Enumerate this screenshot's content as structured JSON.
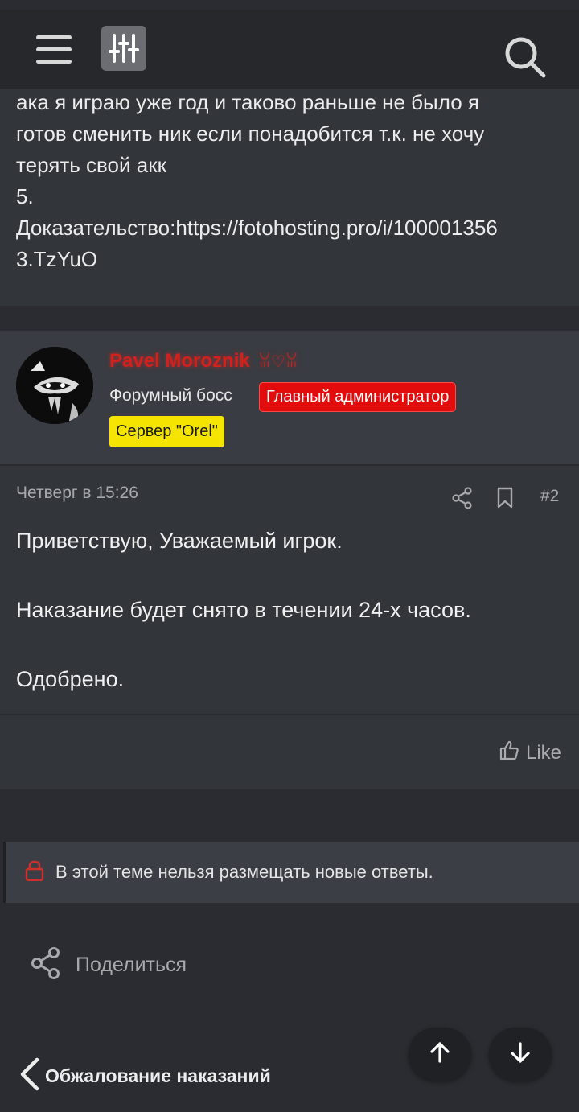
{
  "header": {
    "menu_icon": "hamburger-icon",
    "filter_icon": "sliders-icon",
    "search_icon": "search-icon"
  },
  "previous_post": {
    "text": "ака я играю уже год и таково раньше не было я\nготов сменить ник если понадобится т.к. не хочу\nтерять свой акк\n5.\nДоказательство:https://fotohosting.pro/i/100001356\n3.TzYuO"
  },
  "post": {
    "author": "Pavel Moroznik",
    "author_decoration": "ꈍ♡ꈍ",
    "user_title": "Форумный босс",
    "badge_admin": "Главный администратор",
    "badge_server": "Сервер \"Orel\"",
    "date": "Четверг в 15:26",
    "number": "#2",
    "message": "Приветствую, Уважаемый игрок.\n\nНаказание будет снято в течении 24-х часов.\n\nОдобрено.",
    "like_label": "Like"
  },
  "thread": {
    "locked_notice": "В этой теме нельзя размещать новые ответы.",
    "share_label": "Поделиться",
    "back_label": "Обжалование наказаний"
  },
  "colors": {
    "accent_admin": "#e20c0c",
    "accent_server": "#f5e400",
    "username": "#d0211c"
  }
}
